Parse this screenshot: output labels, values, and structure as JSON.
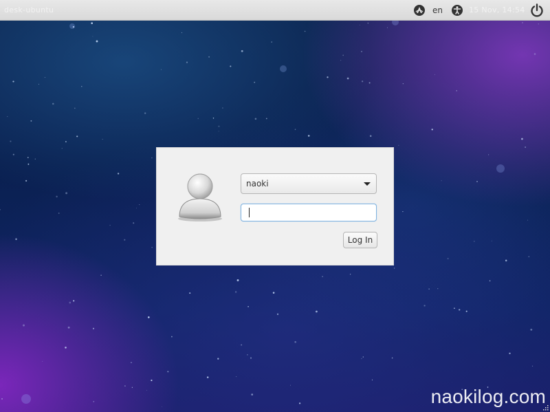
{
  "top_panel": {
    "hostname": "desk-ubuntu",
    "language": "en",
    "clock": "15 Nov, 14:54",
    "icons": [
      "session-icon",
      "accessibility-icon",
      "power-icon"
    ]
  },
  "login": {
    "selected_user": "naoki",
    "password_value": "",
    "login_button_label": "Log In",
    "avatar_icon": "user-avatar-icon",
    "dropdown_icon": "chevron-down-icon"
  },
  "watermark": {
    "text": "naokilog.com"
  },
  "colors": {
    "panel_background": "#e0e0e0",
    "dialog_background": "#f0f0f0",
    "focus_border": "#7fb2e0",
    "wallpaper_base": "#0c2550",
    "wallpaper_accent": "#8c28c8"
  }
}
